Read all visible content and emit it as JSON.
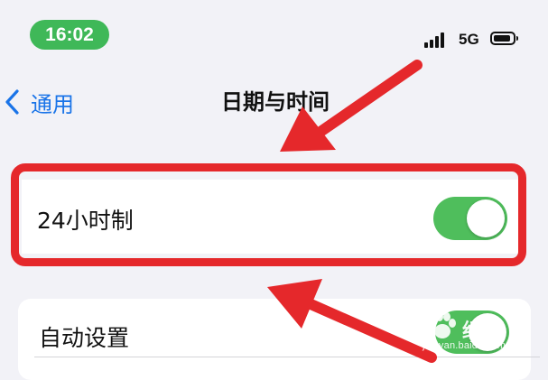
{
  "status_bar": {
    "time": "16:02",
    "network": "5G",
    "signal_icon": "cellular-signal-icon",
    "battery_icon": "battery-icon"
  },
  "nav": {
    "back_label": "通用",
    "back_icon": "chevron-left-icon",
    "title": "日期与时间"
  },
  "settings": {
    "hour24": {
      "label": "24小时制",
      "enabled": true
    },
    "auto_set": {
      "label": "自动设置",
      "enabled": true
    }
  },
  "annotation": {
    "highlight_color": "#e5282b",
    "arrow_color": "#e5282b"
  },
  "watermark": {
    "url": "jingyan.baidu.com",
    "brand": "经验"
  },
  "colors": {
    "accent_blue": "#1a74e8",
    "toggle_on": "#4fbe5c",
    "time_pill": "#3fb858",
    "background": "#f2f2f7"
  }
}
